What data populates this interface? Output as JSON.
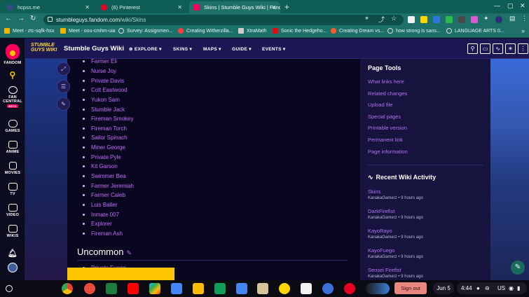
{
  "browser": {
    "tabs": [
      {
        "title": "hcpss.me",
        "active": false
      },
      {
        "title": "(6) Pinterest",
        "active": false
      },
      {
        "title": "Skins | Stumble Guys Wiki | Fand",
        "active": true
      }
    ],
    "url_host": "stumbleguys.fandom.com",
    "url_path": "/wiki/Skins",
    "bookmarks": [
      "Meet - ztc-sqfk-hsu",
      "Meet - oou-cmhm-uia",
      "Survey: Assignmen...",
      "Creating Witherzilla...",
      "XtraMath",
      "Sonic the Hedgeho...",
      "Creating Dream vs...",
      "how strong is sans...",
      "LANGUAGE ARTS 0..."
    ]
  },
  "rail": {
    "items": [
      {
        "label": "FANDOM",
        "icon": "fandom-logo-icon"
      },
      {
        "label": "",
        "icon": "search-icon"
      },
      {
        "label": "FAN CENTRAL",
        "icon": "fan-central-icon",
        "badge": "BETA"
      },
      {
        "label": "GAMES",
        "icon": "games-icon"
      },
      {
        "label": "ANIME",
        "icon": "anime-icon"
      },
      {
        "label": "MOVIES",
        "icon": "movies-icon"
      },
      {
        "label": "TV",
        "icon": "tv-icon"
      },
      {
        "label": "VIDEO",
        "icon": "video-icon"
      },
      {
        "label": "WIKIS",
        "icon": "wikis-icon"
      }
    ]
  },
  "wiki": {
    "logo_text": "STUMBLE GUYS WIKI",
    "name": "Stumble Guys Wiki",
    "nav": [
      "EXPLORE",
      "SKINS",
      "MAPS",
      "GUIDE",
      "EVENTS"
    ]
  },
  "content": {
    "skins": [
      "Farmer Eli",
      "Nurse Joy",
      "Private Davis",
      "Colt Eastwood",
      "Yukon Sam",
      "Stumble Jack",
      "Fireman Smokey",
      "Fireman Torch",
      "Sailor Spinach",
      "Miner George",
      "Private Pyle",
      "Kit Garson",
      "Swimmer Bea",
      "Farmer Jeremiah",
      "Farmer Caleb",
      "Luis Baller",
      "Inmate 007",
      "Explorer",
      "Fireman Ash"
    ],
    "section_heading": "Uncommon",
    "partial_item": "Private Fuego"
  },
  "sidebar": {
    "page_tools_title": "Page Tools",
    "page_tools": [
      "What links here",
      "Related changes",
      "Upload file",
      "Special pages",
      "Printable version",
      "Permanent link",
      "Page information"
    ],
    "activity_title": "Recent Wiki Activity",
    "activity": [
      {
        "page": "Skins",
        "meta": "KanakaGamerz • 9 hours ago"
      },
      {
        "page": "DarkFirefist",
        "meta": "KanakaGamerz • 9 hours ago"
      },
      {
        "page": "KayoRayo",
        "meta": "KanakaGamerz • 9 hours ago"
      },
      {
        "page": "KayoFuego",
        "meta": "KanakaGamerz • 9 hours ago"
      },
      {
        "page": "Sensei Firefist",
        "meta": "KanakaGamerz • 9 hours ago"
      }
    ]
  },
  "shelf": {
    "sign_out": "Sign out",
    "date": "Jun 5",
    "time": "4:44",
    "locale": "US"
  },
  "colors": {
    "accent": "#c46cf7",
    "wiki_header": "#1b1853",
    "fandom_pink": "#fa005a",
    "notice_yellow": "#ffc500"
  }
}
